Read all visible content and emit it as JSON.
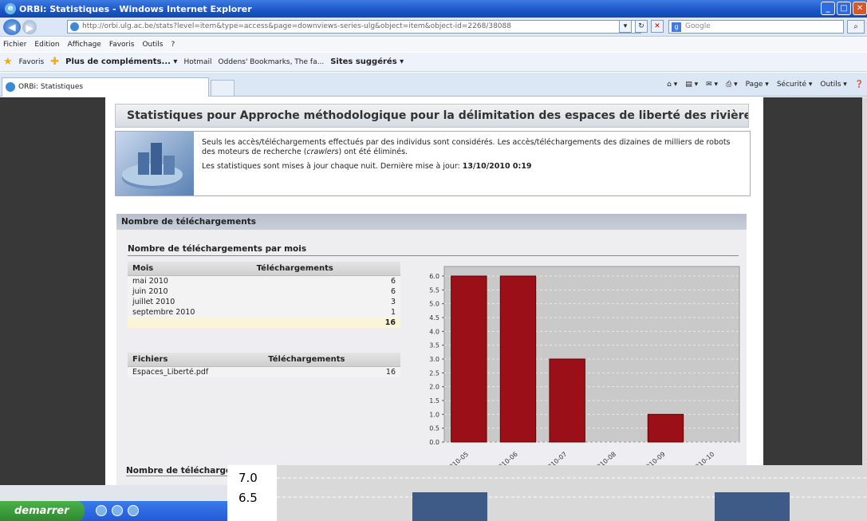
{
  "window": {
    "title": "ORBi: Statistiques - Windows Internet Explorer"
  },
  "address": {
    "url": "http://orbi.ulg.ac.be/stats?level=item&type=access&page=downviews-series-ulg&object=item&object-id=2268/38088",
    "search_placeholder": "Google"
  },
  "menu": [
    "Fichier",
    "Edition",
    "Affichage",
    "Favoris",
    "Outils",
    "?"
  ],
  "favorites": {
    "label": "Favoris",
    "items": [
      "Plus de compléments... ▾",
      "Hotmail",
      "Oddens' Bookmarks, The fa...",
      "Sites suggérés ▾"
    ]
  },
  "tab": {
    "title": "ORBi: Statistiques"
  },
  "tools": [
    "Page ▾",
    "Sécurité ▾",
    "Outils ▾"
  ],
  "page": {
    "title": "Statistiques pour Approche méthodologique pour la délimitation des espaces de liberté des rivières du...",
    "info_1_pre": "Seuls les accès/téléchargements effectués par des individus sont considérés. Les accès/téléchargements des dizaines de milliers de robots des moteurs de recherche (",
    "info_1_em": "crawlers",
    "info_1_post": ") ont été éliminés.",
    "info_2_pre": "Les statistiques sont mises à jour chaque nuit. Dernière mise à jour: ",
    "info_2_date": "13/10/2010 0:19",
    "section": "Nombre de téléchargements",
    "subsection": "Nombre de téléchargements par mois",
    "month_table": {
      "headers": [
        "Mois",
        "Téléchargements"
      ],
      "rows": [
        [
          "mai 2010",
          "6"
        ],
        [
          "juin 2010",
          "6"
        ],
        [
          "juillet 2010",
          "3"
        ],
        [
          "septembre 2010",
          "1"
        ]
      ],
      "total": "16"
    },
    "file_table": {
      "headers": [
        "Fichiers",
        "Téléchargements"
      ],
      "rows": [
        [
          "Espaces_Liberté.pdf",
          "16"
        ]
      ]
    },
    "next_section": "Nombre de télécharge"
  },
  "chart_data": {
    "type": "bar",
    "categories": [
      "2010-05",
      "2010-06",
      "2010-07",
      "2010-08",
      "2010-09",
      "2010-10"
    ],
    "values": [
      6,
      6,
      3,
      0,
      1,
      0
    ],
    "ylim": [
      0,
      6
    ],
    "yticks": [
      "0.0",
      "0.5",
      "1.0",
      "1.5",
      "2.0",
      "2.5",
      "3.0",
      "3.5",
      "4.0",
      "4.5",
      "5.0",
      "5.5",
      "6.0"
    ],
    "color": "#9b1018",
    "grid": true
  },
  "overlay_chart": {
    "yticks": [
      "7.0",
      "6.5"
    ],
    "bar_color": "#3e5a86"
  },
  "taskbar": {
    "start": "demarrer"
  }
}
